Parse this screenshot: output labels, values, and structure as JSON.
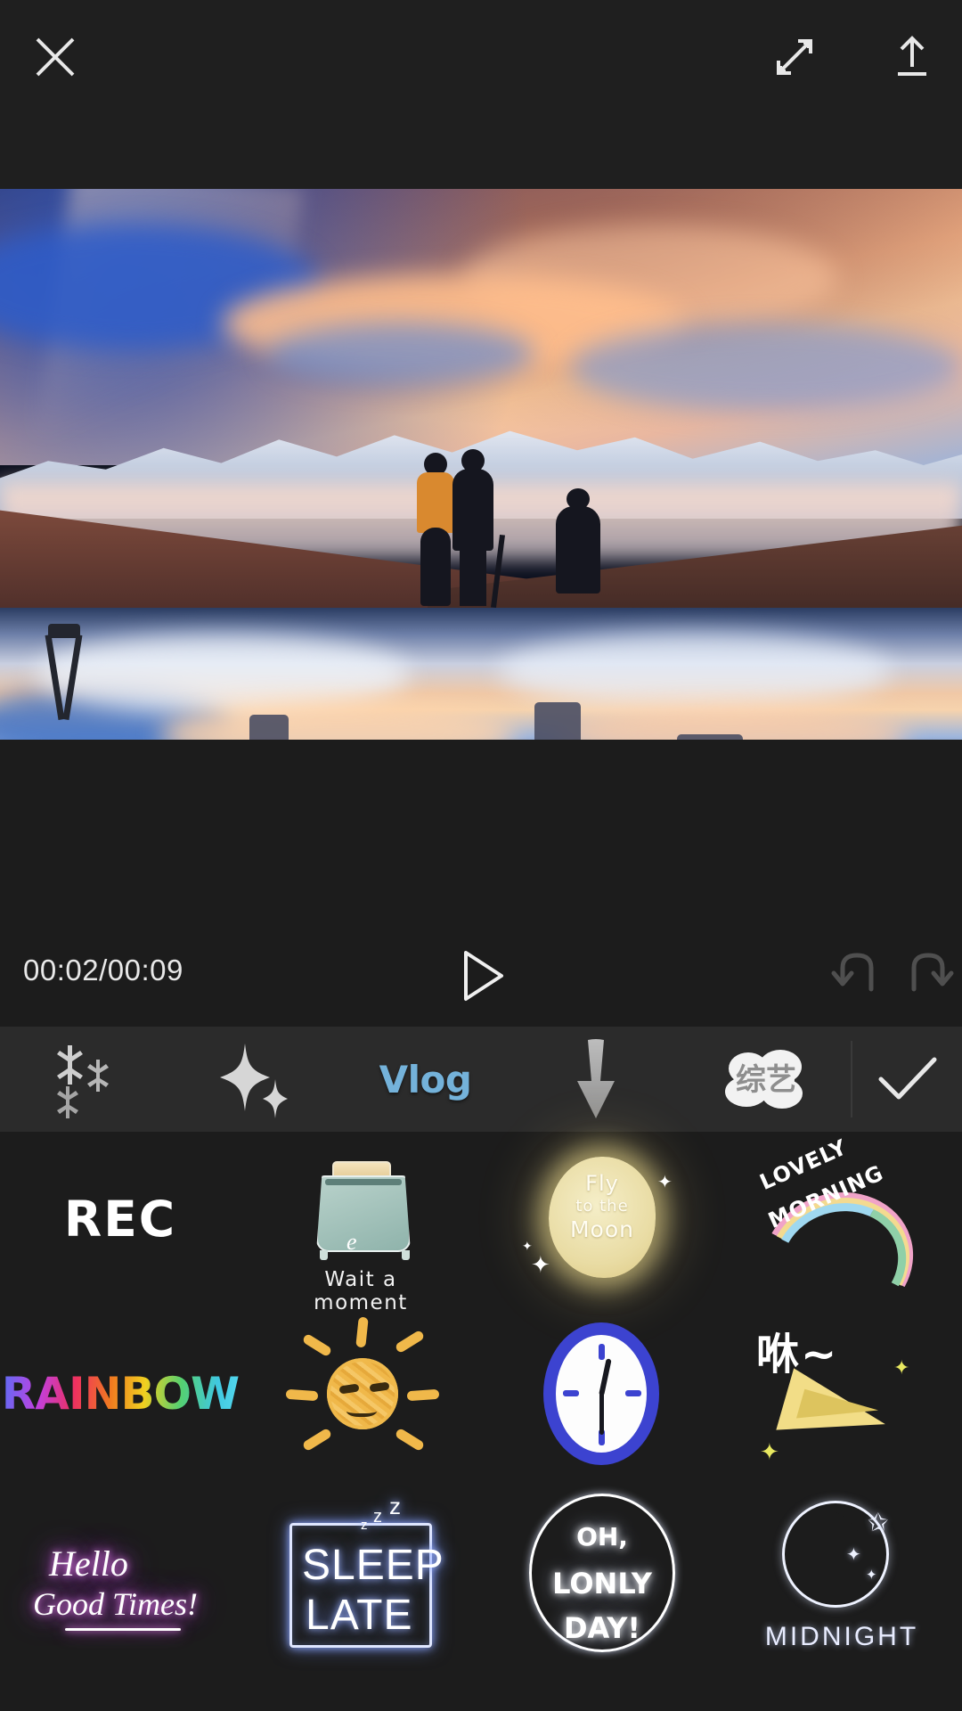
{
  "topbar": {
    "close_icon": "close-x-icon",
    "expand_icon": "fullscreen-expand-icon",
    "export_icon": "export-upload-icon"
  },
  "preview": {
    "scene_description": "Sunset mountain lake reflection with three silhouetted photographers"
  },
  "playback": {
    "timecode": "00:02/00:09",
    "current_time": "00:02",
    "total_time": "00:09",
    "play_icon": "play-triangle-icon",
    "undo_icon": "undo-arrow-icon",
    "redo_icon": "redo-arrow-icon"
  },
  "tabs": {
    "active": "Vlog",
    "items": [
      {
        "id": "snow",
        "label": "",
        "icon": "snowflake-cluster-icon",
        "active": false
      },
      {
        "id": "sparkle",
        "label": "",
        "icon": "sparkle-star-icon",
        "active": false
      },
      {
        "id": "vlog",
        "label": "Vlog",
        "icon": "vlog-text-icon",
        "active": true
      },
      {
        "id": "arrow",
        "label": "",
        "icon": "down-arrow-icon",
        "active": false
      },
      {
        "id": "variety",
        "label": "综艺",
        "icon": "variety-show-text-icon",
        "active": false
      }
    ],
    "confirm_icon": "checkmark-confirm-icon"
  },
  "stickers": {
    "rows": [
      [
        {
          "id": "rec",
          "name": "REC",
          "text": "REC"
        },
        {
          "id": "toaster",
          "name": "Wait a moment toaster",
          "text": "Wait a moment",
          "accent": "#9fc1b8"
        },
        {
          "id": "moon",
          "name": "Fly to the Moon",
          "line1": "Fly",
          "line2": "to the",
          "line3": "Moon",
          "accent": "#e9dca4"
        },
        {
          "id": "lovely-morning",
          "name": "Lovely Morning rainbow",
          "line1": "LOVELY",
          "line2": "MORNING"
        }
      ],
      [
        {
          "id": "rainbow",
          "name": "RAINBOW",
          "text": "RAINBOW"
        },
        {
          "id": "sun",
          "name": "Scribble sun",
          "accent": "#f0b84a"
        },
        {
          "id": "clock",
          "name": "Blue clock",
          "accent": "#3c43d0"
        },
        {
          "id": "xiu-plane",
          "name": "Xiu paper plane",
          "text": "咻~",
          "accent": "#f2dd87"
        }
      ],
      [
        {
          "id": "hello-good-times",
          "name": "Hello Good Times neon",
          "line1": "Hello",
          "line2": "Good Times!"
        },
        {
          "id": "sleep-late",
          "name": "SLEEP LATE neon",
          "line1": "SLEEP",
          "line2": "LATE",
          "zzz": "z"
        },
        {
          "id": "oh-lonly-day",
          "name": "Oh Lonly Day neon",
          "line1": "OH,",
          "line2": "LONLY",
          "line3": "DAY!"
        },
        {
          "id": "midnight",
          "name": "Midnight moon",
          "text": "MIDNIGHT"
        }
      ]
    ]
  },
  "colors": {
    "background": "#1c1c1c",
    "topbar_bg": "#1f1f1f",
    "tabbar_bg": "#2b2b2b",
    "accent_active": "#74b2da",
    "icon": "#e8e8e8",
    "dim_icon": "#5a5a5a"
  }
}
